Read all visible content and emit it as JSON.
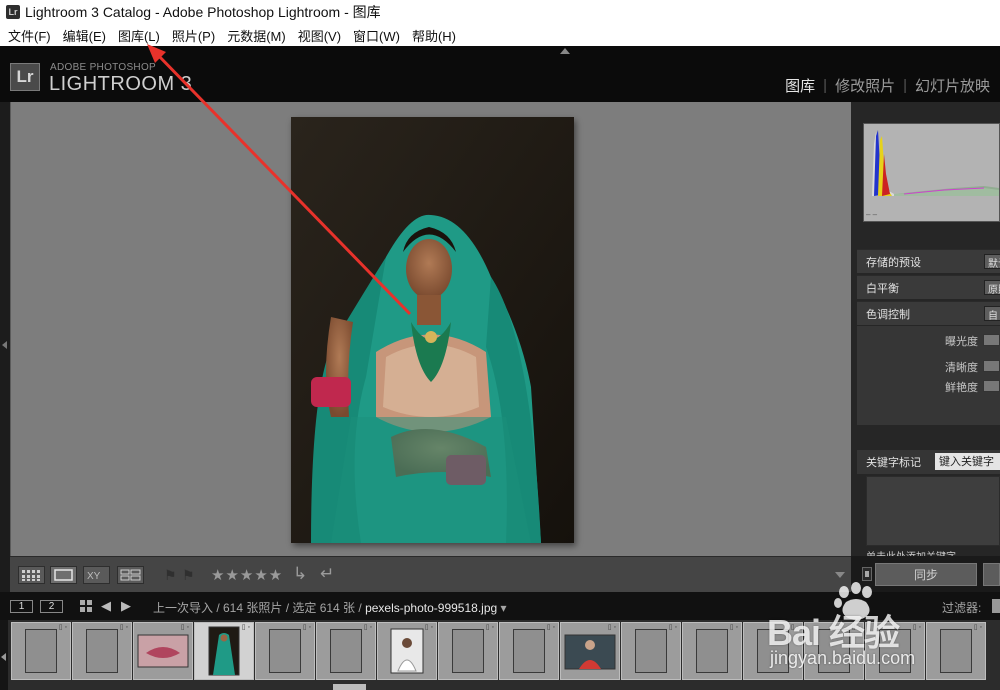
{
  "window": {
    "icon": "Lr",
    "title": "Lightroom 3 Catalog - Adobe Photoshop Lightroom - 图库"
  },
  "menu": [
    {
      "label": "文件(F)"
    },
    {
      "label": "编辑(E)"
    },
    {
      "label": "图库(L)"
    },
    {
      "label": "照片(P)"
    },
    {
      "label": "元数据(M)"
    },
    {
      "label": "视图(V)"
    },
    {
      "label": "窗口(W)"
    },
    {
      "label": "帮助(H)"
    }
  ],
  "identity": {
    "badge": "Lr",
    "subtitle": "ADOBE PHOTOSHOP",
    "title": "LIGHTROOM 3"
  },
  "modules": [
    {
      "label": "图库",
      "active": true
    },
    {
      "label": "修改照片",
      "active": false
    },
    {
      "label": "幻灯片放映",
      "active": false
    }
  ],
  "toolbar": {
    "stars": "★★★★★"
  },
  "right_panel": {
    "histogram_ticks": "–                  –",
    "saved_preset": {
      "label": "存储的预设",
      "value": "默认"
    },
    "white_balance": {
      "label": "白平衡",
      "value": "原照"
    },
    "tone_control": {
      "label": "色调控制",
      "value": "自"
    },
    "exposure": "曝光度",
    "clarity": "清晰度",
    "vibrance": "鲜艳度",
    "keywording": {
      "label": "关键字标记",
      "input": "键入关键字"
    },
    "keyword_hint": "单击此处添加关键字",
    "sync": "同步"
  },
  "filmstrip_bar": {
    "screen1": "1",
    "screen2": "2",
    "source": "上一次导入 / 614 张照片 / 选定 614 张 / ",
    "filename": "pexels-photo-999518.jpg",
    "filter_label": "过滤器:"
  },
  "filmstrip": [
    {
      "kind": "blank"
    },
    {
      "kind": "blank"
    },
    {
      "kind": "lips"
    },
    {
      "kind": "bride",
      "selected": true
    },
    {
      "kind": "blank"
    },
    {
      "kind": "blank"
    },
    {
      "kind": "portrait"
    },
    {
      "kind": "blank"
    },
    {
      "kind": "blank"
    },
    {
      "kind": "redshirt"
    },
    {
      "kind": "blank"
    },
    {
      "kind": "blank"
    },
    {
      "kind": "blank"
    },
    {
      "kind": "blank"
    },
    {
      "kind": "blank"
    },
    {
      "kind": "blank"
    }
  ],
  "watermark": {
    "text": "Bai 经验",
    "url": "jingyan.baidu.com"
  },
  "colors": {
    "annotation_arrow": "#e8322b",
    "preview_bg": "#7d7d7d",
    "sari": "#1f9a86"
  }
}
